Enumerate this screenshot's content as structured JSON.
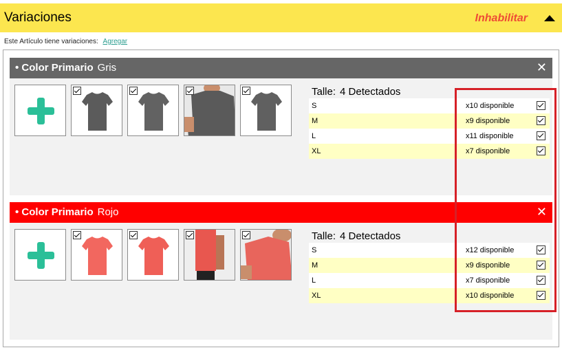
{
  "header": {
    "title": "Variaciones",
    "toggle_label": "Inhabilitar"
  },
  "subline": {
    "text": "Este Artículo tiene variaciones:",
    "link": "Agregar"
  },
  "groups": [
    {
      "label": "• Color Primario",
      "value": "Gris",
      "head_color": "#666666",
      "thumb_icons": [
        "gray-tshirt-icon",
        "gray-tshirt-icon",
        "gray-tshirt-model-icon",
        "gray-tshirt-icon"
      ],
      "size_label": "Talle:",
      "size_count": "4 Detectados",
      "sizes": [
        {
          "size": "S",
          "available": "x10 disponible",
          "checked": true
        },
        {
          "size": "M",
          "available": "x9 disponible",
          "checked": true
        },
        {
          "size": "L",
          "available": "x11 disponible",
          "checked": true
        },
        {
          "size": "XL",
          "available": "x7 disponible",
          "checked": true
        }
      ]
    },
    {
      "label": "• Color Primario",
      "value": "Rojo",
      "head_color": "#ff0000",
      "thumb_icons": [
        "red-tshirt-icon",
        "red-tshirt-icon",
        "red-tshirt-model-icon",
        "red-tshirt-model-icon"
      ],
      "size_label": "Talle:",
      "size_count": "4 Detectados",
      "sizes": [
        {
          "size": "S",
          "available": "x12 disponible",
          "checked": true
        },
        {
          "size": "M",
          "available": "x9 disponible",
          "checked": true
        },
        {
          "size": "L",
          "available": "x7 disponible",
          "checked": true
        },
        {
          "size": "XL",
          "available": "x10 disponible",
          "checked": true
        }
      ]
    }
  ],
  "colors": {
    "header_bg": "#fce64f",
    "toggle": "#ee4b35",
    "link": "#2a9d8f",
    "plus": "#2bbf98",
    "row_alt": "#ffffc4",
    "highlight": "#d62027"
  }
}
